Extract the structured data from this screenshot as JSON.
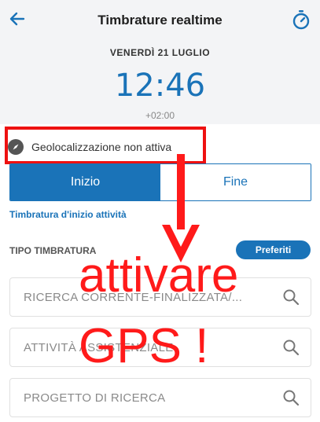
{
  "header": {
    "title": "Timbrature realtime",
    "date": "VENERDÌ 21 LUGLIO",
    "time": "12:46",
    "timezone": "+02:00",
    "back_icon": "arrow-left-icon",
    "timer_icon": "stopwatch-icon"
  },
  "geolocation": {
    "icon": "compass-icon",
    "status": "Geolocalizzazione non attiva"
  },
  "segment": {
    "start_label": "Inizio",
    "end_label": "Fine",
    "selected": "Inizio"
  },
  "clock_type_label": "Timbratura d'inizio attività",
  "section": {
    "label": "TIPO TIMBRATURA",
    "favorites_button": "Preferiti"
  },
  "fields": [
    {
      "value": "RICERCA CORRENTE-FINALIZZATA/..."
    },
    {
      "value": "ATTIVITÀ ASSISTENZIALE"
    },
    {
      "value": "PROGETTO DI RICERCA"
    }
  ],
  "annotation": {
    "line1": "attivare",
    "line2": "GPS !",
    "color": "#ff1a1a"
  },
  "colors": {
    "accent": "#1a73b8",
    "header_bg": "#f3f4f6"
  }
}
